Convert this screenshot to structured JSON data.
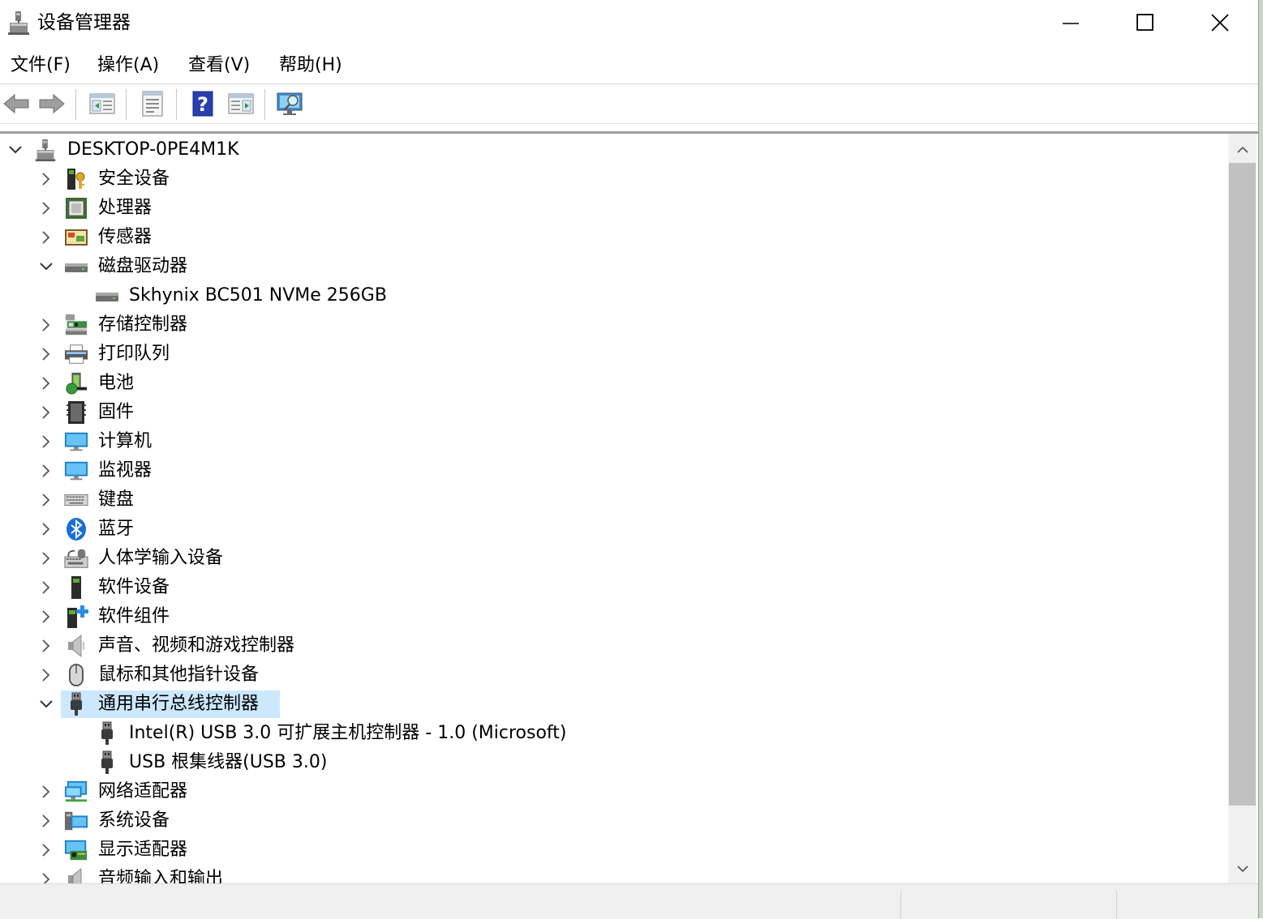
{
  "window": {
    "title": "设备管理器",
    "accent": "#cce8ff"
  },
  "menu": [
    {
      "label": "文件(F)",
      "name": "menu-file"
    },
    {
      "label": "操作(A)",
      "name": "menu-action"
    },
    {
      "label": "查看(V)",
      "name": "menu-view"
    },
    {
      "label": "帮助(H)",
      "name": "menu-help"
    }
  ],
  "toolbar": [
    {
      "name": "back-button",
      "icon": "back-arrow-icon"
    },
    {
      "name": "forward-button",
      "icon": "forward-arrow-icon"
    },
    {
      "name": "show-hide-console-tree-button",
      "icon": "console-tree-icon"
    },
    {
      "name": "properties-button",
      "icon": "properties-icon"
    },
    {
      "name": "help-button",
      "icon": "help-icon"
    },
    {
      "name": "show-action-pane-button",
      "icon": "action-pane-icon"
    },
    {
      "name": "scan-hardware-changes-button",
      "icon": "scan-monitor-icon"
    }
  ],
  "tree": {
    "root": "DESKTOP-0PE4M1K",
    "nodes": [
      {
        "label": "安全设备",
        "icon": "security-key-icon",
        "level": 1,
        "expanded": false
      },
      {
        "label": "处理器",
        "icon": "processor-chip-icon",
        "level": 1,
        "expanded": false
      },
      {
        "label": "传感器",
        "icon": "sensor-icon",
        "level": 1,
        "expanded": false
      },
      {
        "label": "磁盘驱动器",
        "icon": "disk-drive-icon",
        "level": 1,
        "expanded": true
      },
      {
        "label": "Skhynix BC501 NVMe 256GB",
        "icon": "disk-drive-icon",
        "level": 2
      },
      {
        "label": "存储控制器",
        "icon": "storage-controller-icon",
        "level": 1,
        "expanded": false
      },
      {
        "label": "打印队列",
        "icon": "printer-icon",
        "level": 1,
        "expanded": false
      },
      {
        "label": "电池",
        "icon": "battery-icon",
        "level": 1,
        "expanded": false
      },
      {
        "label": "固件",
        "icon": "firmware-icon",
        "level": 1,
        "expanded": false
      },
      {
        "label": "计算机",
        "icon": "computer-monitor-icon",
        "level": 1,
        "expanded": false
      },
      {
        "label": "监视器",
        "icon": "display-monitor-icon",
        "level": 1,
        "expanded": false
      },
      {
        "label": "键盘",
        "icon": "keyboard-icon",
        "level": 1,
        "expanded": false
      },
      {
        "label": "蓝牙",
        "icon": "bluetooth-icon",
        "level": 1,
        "expanded": false
      },
      {
        "label": "人体学输入设备",
        "icon": "hid-icon",
        "level": 1,
        "expanded": false
      },
      {
        "label": "软件设备",
        "icon": "software-device-icon",
        "level": 1,
        "expanded": false
      },
      {
        "label": "软件组件",
        "icon": "software-component-icon",
        "level": 1,
        "expanded": false
      },
      {
        "label": "声音、视频和游戏控制器",
        "icon": "speaker-icon",
        "level": 1,
        "expanded": false
      },
      {
        "label": "鼠标和其他指针设备",
        "icon": "mouse-icon",
        "level": 1,
        "expanded": false
      },
      {
        "label": "通用串行总线控制器",
        "icon": "usb-plug-icon",
        "level": 1,
        "expanded": true,
        "selected": true
      },
      {
        "label": "Intel(R) USB 3.0 可扩展主机控制器 - 1.0 (Microsoft)",
        "icon": "usb-plug-icon",
        "level": 2
      },
      {
        "label": "USB 根集线器(USB 3.0)",
        "icon": "usb-plug-icon",
        "level": 2
      },
      {
        "label": "网络适配器",
        "icon": "network-adapter-icon",
        "level": 1,
        "expanded": false
      },
      {
        "label": "系统设备",
        "icon": "system-device-icon",
        "level": 1,
        "expanded": false
      },
      {
        "label": "显示适配器",
        "icon": "display-adapter-icon",
        "level": 1,
        "expanded": false
      },
      {
        "label": "音频输入和输出",
        "icon": "audio-io-icon",
        "level": 1,
        "expanded": false
      }
    ]
  }
}
